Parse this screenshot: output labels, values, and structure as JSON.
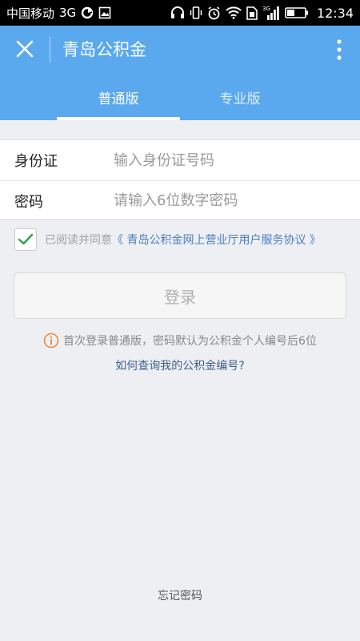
{
  "status_bar": {
    "carrier": "中国移动",
    "network": "3G",
    "signal_label": "3G",
    "time": "12:34",
    "icons": [
      "sync-icon",
      "image-icon",
      "headphones-icon",
      "vibrate-icon",
      "alarm-icon",
      "wifi-icon",
      "sim-icon",
      "signal-icon",
      "battery-icon"
    ]
  },
  "header": {
    "title": "青岛公积金",
    "close_icon": "close-icon",
    "more_icon": "more-vertical-icon",
    "color": "#5aa9ef"
  },
  "tabs": [
    {
      "label": "普通版",
      "active": true
    },
    {
      "label": "专业版",
      "active": false
    }
  ],
  "form": {
    "id_label": "身份证",
    "id_placeholder": "输入身份证号码",
    "password_label": "密码",
    "password_placeholder": "请输入6位数字密码"
  },
  "agreement": {
    "checked": true,
    "prefix": "已阅读并同意",
    "link": "《 青岛公积金网上营业厅用户服务协议 》"
  },
  "login_button": "登录",
  "notice": "首次登录普通版，密码默认为公积金个人编号后6位",
  "help_link": "如何查询我的公积金编号?",
  "forgot_password": "忘记密码",
  "colors": {
    "accent": "#5aa9ef",
    "check": "#2ca24a",
    "info": "#f08a3c",
    "link": "#4a7fbf"
  }
}
